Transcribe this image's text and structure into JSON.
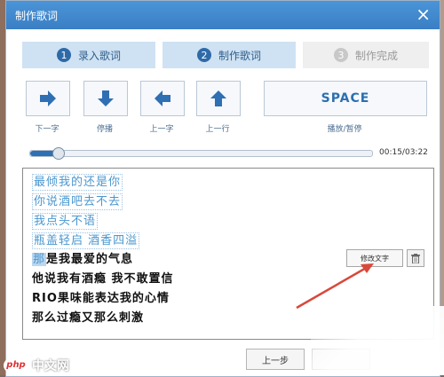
{
  "window": {
    "title": "制作歌词",
    "close_glyph": "×"
  },
  "steps": [
    {
      "num": "1",
      "label": "录入歌词"
    },
    {
      "num": "2",
      "label": "制作歌词"
    },
    {
      "num": "3",
      "label": "制作完成"
    }
  ],
  "controls": {
    "next_word": "下一字",
    "pause": "停播",
    "prev_word": "上一字",
    "prev_line": "上一行",
    "space": "SPACE",
    "play_pause": "播放/暂停"
  },
  "playback": {
    "time": "00:15/03:22",
    "progress": 0.08
  },
  "lyrics": [
    {
      "text": "最倾我的还是你",
      "state": "pending"
    },
    {
      "text": "你说酒吧去不去",
      "state": "pending"
    },
    {
      "text": "我点头不语",
      "state": "pending"
    },
    {
      "text": "瓶盖轻启 酒香四溢",
      "state": "pending"
    },
    {
      "highlight": "那",
      "text": "是我最爱的气息",
      "state": "current"
    },
    {
      "text": "他说我有酒瘾 我不敢置信",
      "state": "normal"
    },
    {
      "text": "RIO果味能表达我的心情",
      "state": "normal"
    },
    {
      "text": "那么过瘾又那么刺激",
      "state": "normal"
    }
  ],
  "edit_text_label": "修改文字",
  "footer": {
    "prev_label": "上一步"
  },
  "watermark": {
    "badge": "php",
    "text": "中文网"
  },
  "colors": {
    "accent": "#2f6fb3",
    "title_bar": "#3a7fc4",
    "arrow": "#d9483b"
  }
}
